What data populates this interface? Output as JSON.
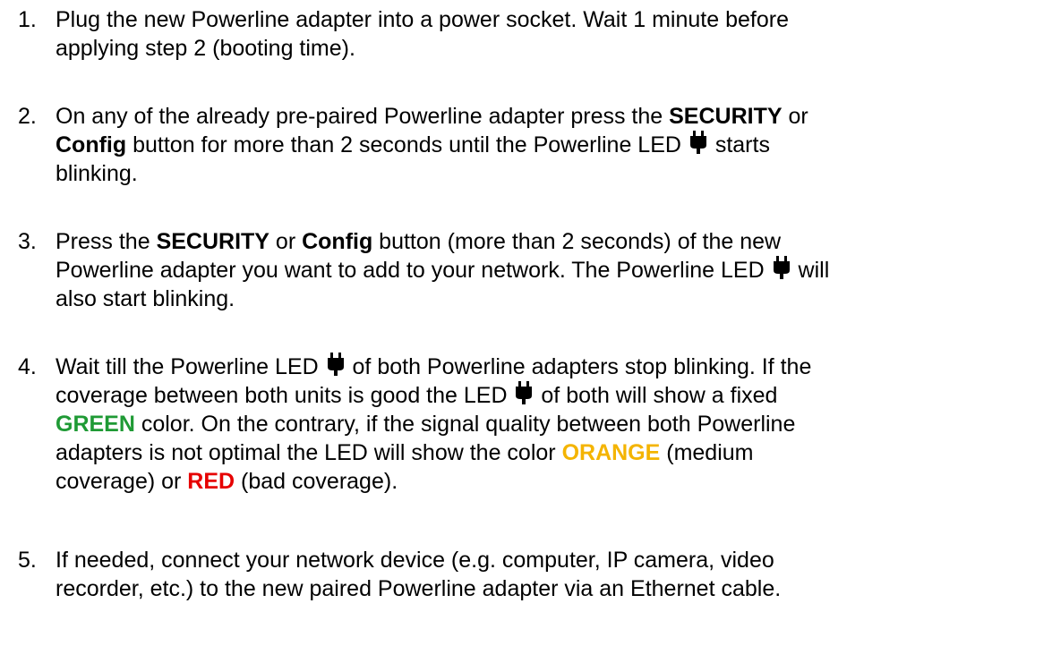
{
  "steps": [
    {
      "number": "1.",
      "lines": [
        [
          "Plug the new Powerline adapter into a power socket. Wait 1 minute before"
        ],
        [
          "applying step 2 (booting time)."
        ]
      ]
    },
    {
      "number": "2.",
      "l1_a": "On any of the already pre-paired Powerline adapter press the ",
      "security": "SECURITY",
      "l1_b": " or",
      "config": "Config",
      "l2_a": " button for more than 2 seconds until the Powerline LED ",
      "l2_b": " starts",
      "l3": "blinking.",
      "icon": "powerline-led-icon"
    },
    {
      "number": "3.",
      "l1_a": "Press the ",
      "security": "SECURITY",
      "l1_b": " or ",
      "config": "Config",
      "l1_c": " button (more than 2 seconds) of the new",
      "l2_a": "Powerline adapter you want to add to your network. The Powerline LED ",
      "l2_b": " will",
      "l3": "also start blinking.",
      "icon": "powerline-led-icon"
    },
    {
      "number": "4.",
      "l1_a": "Wait till the Powerline LED ",
      "l1_b": " of both Powerline adapters stop blinking. If the",
      "l2_a": "coverage between both units is good the LED ",
      "l2_b": " of both will show a fixed",
      "green": "GREEN",
      "l3_b": " color. On the contrary, if the signal quality between both Powerline",
      "l4_a": "adapters is not optimal the LED will show the color ",
      "orange": "ORANGE",
      "l4_b": " (medium",
      "l5_a": "coverage) or ",
      "red": "RED",
      "l5_b": " (bad coverage).",
      "icon": "powerline-led-icon",
      "colors": {
        "green": "#1f9a35",
        "orange": "#f4b400",
        "red": "#e60000"
      }
    },
    {
      "number": "5.",
      "l1": "If needed, connect your network device (e.g. computer, IP camera, video",
      "l2": "recorder, etc.) to the new paired Powerline adapter via an Ethernet cable."
    }
  ]
}
